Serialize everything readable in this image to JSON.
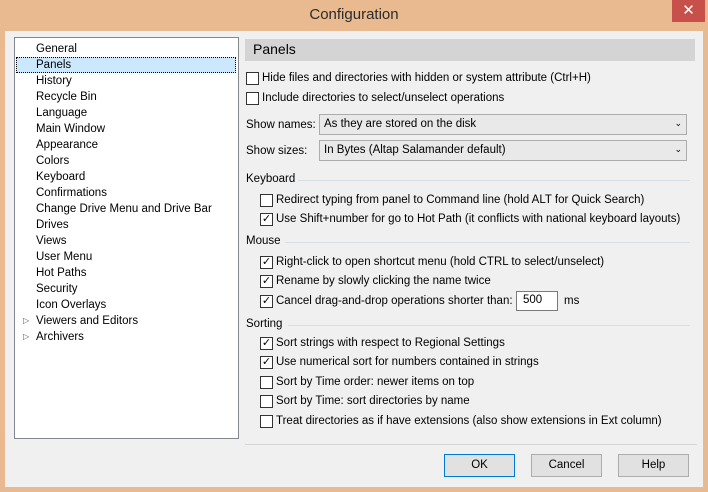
{
  "window": {
    "title": "Configuration",
    "close_glyph": "✕"
  },
  "tree": {
    "items": [
      {
        "label": "General",
        "expander": false
      },
      {
        "label": "Panels",
        "expander": false,
        "selected": true
      },
      {
        "label": "History",
        "expander": false
      },
      {
        "label": "Recycle Bin",
        "expander": false
      },
      {
        "label": "Language",
        "expander": false
      },
      {
        "label": "Main Window",
        "expander": false
      },
      {
        "label": "Appearance",
        "expander": false
      },
      {
        "label": "Colors",
        "expander": false
      },
      {
        "label": "Keyboard",
        "expander": false
      },
      {
        "label": "Confirmations",
        "expander": false
      },
      {
        "label": "Change Drive Menu and Drive Bar",
        "expander": false
      },
      {
        "label": "Drives",
        "expander": false
      },
      {
        "label": "Views",
        "expander": false
      },
      {
        "label": "User Menu",
        "expander": false
      },
      {
        "label": "Hot Paths",
        "expander": false
      },
      {
        "label": "Security",
        "expander": false
      },
      {
        "label": "Icon Overlays",
        "expander": false
      },
      {
        "label": "Viewers and Editors",
        "expander": true
      },
      {
        "label": "Archivers",
        "expander": true
      }
    ],
    "expander_glyph": "▷"
  },
  "panel": {
    "header": "Panels",
    "hide_hidden": {
      "label": "Hide files and directories with hidden or system attribute (Ctrl+H)",
      "checked": false
    },
    "include_dirs": {
      "label": "Include directories to select/unselect operations",
      "checked": false
    },
    "show_names": {
      "label": "Show names:",
      "value": "As they are stored on the disk"
    },
    "show_sizes": {
      "label": "Show sizes:",
      "value": "In Bytes (Altap Salamander default)"
    },
    "combo_arrow": "⌄",
    "keyboard": {
      "title": "Keyboard",
      "redirect": {
        "label": "Redirect typing from panel to Command line (hold ALT for Quick Search)",
        "checked": false
      },
      "shift_number": {
        "label": "Use Shift+number for go to Hot Path (it conflicts with national keyboard layouts)",
        "checked": true
      }
    },
    "mouse": {
      "title": "Mouse",
      "right_click": {
        "label": "Right-click to open shortcut menu (hold CTRL to select/unselect)",
        "checked": true
      },
      "rename_click": {
        "label": "Rename by slowly clicking the name twice",
        "checked": true
      },
      "cancel_drag": {
        "label": "Cancel drag-and-drop operations shorter than:",
        "checked": true
      },
      "drag_value": "500",
      "drag_unit": "ms"
    },
    "sorting": {
      "title": "Sorting",
      "regional": {
        "label": "Sort strings with respect to Regional Settings",
        "checked": true
      },
      "numerical": {
        "label": "Use numerical sort for numbers contained in strings",
        "checked": true
      },
      "time_order": {
        "label": "Sort by Time order: newer items on top",
        "checked": false
      },
      "time_dirs": {
        "label": "Sort by Time: sort directories by name",
        "checked": false
      },
      "dir_ext": {
        "label": "Treat directories as if have extensions (also show extensions in Ext column)",
        "checked": false
      }
    }
  },
  "buttons": {
    "ok": "OK",
    "cancel": "Cancel",
    "help": "Help"
  },
  "check_glyph": "✓"
}
